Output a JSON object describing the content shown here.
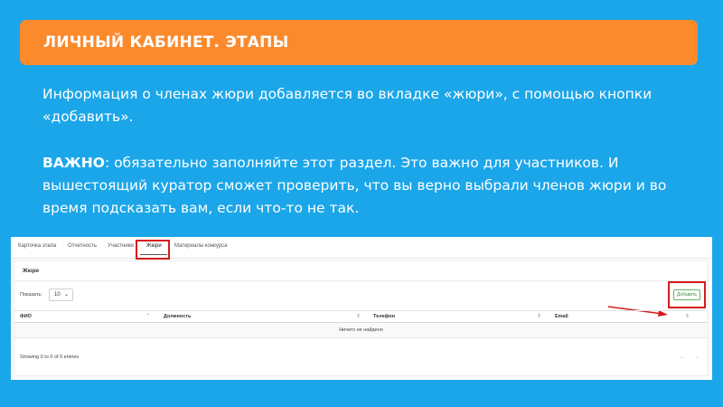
{
  "header": {
    "title": "ЛИЧНЫЙ КАБИНЕТ. ЭТАПЫ"
  },
  "text": {
    "p1": "Информация о членах жюри добавляется во вкладке «жюри», с помощью кнопки «добавить».",
    "p2_bold": "ВАЖНО",
    "p2_rest": ": обязательно заполняйте этот раздел. Это важно для участников. И вышестоящий куратор сможет проверить, что вы верно выбрали членов жюри и во время подсказать вам, если что-то не так."
  },
  "screenshot": {
    "tabs": [
      "Карточка этапа",
      "Отчетность",
      "Участники",
      "Жюри",
      "Материалы конкурса"
    ],
    "active_tab": "Жюри",
    "card_title": "Жюри",
    "show_label": "Показать:",
    "show_value": "10",
    "add_button": "Добавить",
    "columns": [
      "ФИО",
      "Должность",
      "Телефон",
      "Email"
    ],
    "empty_message": "Ничего не найдено",
    "info": "Showing 0 to 0 of 0 entries",
    "pager_prev": "←",
    "pager_next": "→"
  },
  "colors": {
    "background": "#1ba6e9",
    "title_bar": "#fb8a2d",
    "highlight": "#d61b1b",
    "add_button_border": "#5cb85c"
  },
  "icons": {
    "select_chevron": "chevron-down-icon",
    "sort": "sort-icon",
    "arrow": "arrow-right-icon"
  }
}
